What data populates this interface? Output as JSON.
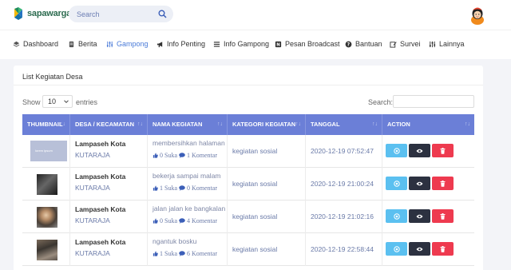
{
  "header": {
    "brand": "sapawarga",
    "search_placeholder": "Search"
  },
  "nav": [
    {
      "label": "Dashboard",
      "icon": "layers-icon"
    },
    {
      "label": "Berita",
      "icon": "document-icon"
    },
    {
      "label": "Gampong",
      "icon": "sliders-icon",
      "active": true
    },
    {
      "label": "Info Penting",
      "icon": "megaphone-icon"
    },
    {
      "label": "Info Gampong",
      "icon": "list-icon"
    },
    {
      "label": "Pesan Broadcast",
      "icon": "broadcast-icon"
    },
    {
      "label": "Bantuan",
      "icon": "question-icon"
    },
    {
      "label": "Survei",
      "icon": "edit-icon"
    },
    {
      "label": "Lainnya",
      "icon": "sliders-icon"
    }
  ],
  "card": {
    "title": "List Kegiatan Desa",
    "show_label": "Show",
    "show_value": "10",
    "entries_label": "entries",
    "search_label": "Search:"
  },
  "table": {
    "columns": [
      "THUMBNAIL",
      "DESA / KECAMATAN",
      "NAMA KEGIATAN",
      "KATEGORI KEGIATAN",
      "TANGGAL",
      "ACTION"
    ],
    "rows": [
      {
        "thumb_label": "lorem ipsum",
        "desa": "Lampaseh Kota",
        "kecamatan": "KUTARAJA",
        "kegiatan": "membersihkan halaman",
        "suka": "0 Suka",
        "komentar": "1 Komentar",
        "kategori": "kegiatan sosial",
        "tanggal": "2020-12-19 07:52:47"
      },
      {
        "thumb_label": "",
        "desa": "Lampaseh Kota",
        "kecamatan": "KUTARAJA",
        "kegiatan": "bekerja sampai malam",
        "suka": "1 Suka",
        "komentar": "0 Komentar",
        "kategori": "kegiatan sosial",
        "tanggal": "2020-12-19 21:00:24"
      },
      {
        "thumb_label": "",
        "desa": "Lampaseh Kota",
        "kecamatan": "KUTARAJA",
        "kegiatan": "jalan jalan ke bangkalan",
        "suka": "0 Suka",
        "komentar": "4 Komentar",
        "kategori": "kegiatan sosial",
        "tanggal": "2020-12-19 21:02:16"
      },
      {
        "thumb_label": "",
        "desa": "Lampaseh Kota",
        "kecamatan": "KUTARAJA",
        "kegiatan": "ngantuk bosku",
        "suka": "1 Suka",
        "komentar": "6 Komentar",
        "kategori": "kegiatan sosial",
        "tanggal": "2020-12-19 22:58:44"
      }
    ]
  },
  "colors": {
    "accent": "#4a7bd8",
    "table_header": "#6b7fd7",
    "btn_info": "#5bc0f0",
    "btn_dark": "#2c3140",
    "btn_danger": "#ee3a4f"
  }
}
